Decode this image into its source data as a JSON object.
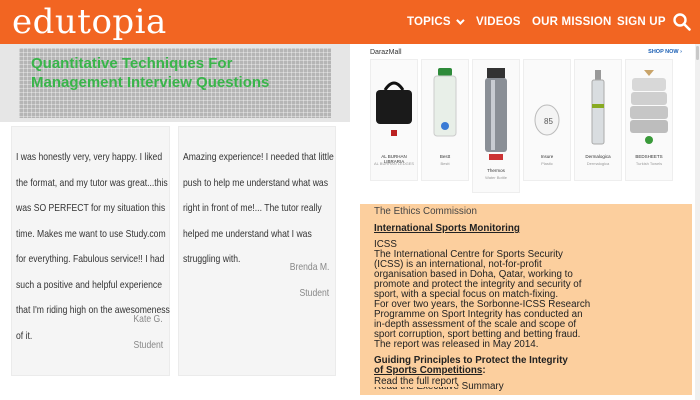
{
  "header": {
    "logo": "edutopia",
    "nav": [
      {
        "label": "TOPICS"
      },
      {
        "label": "VIDEOS"
      },
      {
        "label": "OUR MISSION"
      },
      {
        "label": "SIGN UP"
      }
    ],
    "brand_color": "#f26522"
  },
  "article": {
    "title": "Quantitative Techniques For Management Interview Questions",
    "title_color": "#39b54a"
  },
  "testimonials": [
    {
      "quote": "I was honestly very, very happy. I liked the format, and my tutor was great...this was SO PERFECT for my situation this time. Makes me want to use Study.com for everything. Fabulous service!! I had such a positive and helpful experience that I'm riding high on the awesomeness of it.",
      "author": "Kate G.",
      "role": "Student"
    },
    {
      "quote": "Amazing experience! I needed that little push to help me understand what was right in front of me!... The tutor really helped me understand what I was struggling with.",
      "author": "Brenda M.",
      "role": "Student"
    }
  ],
  "ad": {
    "brand": "DarazMall",
    "shop_now": "SHOP NOW",
    "items": [
      {
        "name": "AL BURHAN LIBRARIA",
        "price": "AL BURHAN LEDGES",
        "icon": "black-handbag-icon"
      },
      {
        "name": "Bestt",
        "price": "Bestt",
        "icon": "bottle-icon"
      },
      {
        "name": "Thermos",
        "price": "Water Bottle",
        "icon": "thermos-icon"
      },
      {
        "name": "Insure",
        "price": "Plastic",
        "icon": "egg-device-icon"
      },
      {
        "name": "Dermalogica",
        "price": "Dermalogica",
        "icon": "serum-bottle-icon"
      },
      {
        "name": "BEDSHEETS",
        "price": "Turkish Towels",
        "icon": "towel-stack-icon"
      }
    ]
  },
  "ethics": {
    "heading": "The Ethics Commission",
    "sub_heading": "International Sports Monitoring",
    "org": "ICSS",
    "lines": [
      "The International Centre for Sports Security",
      "(ICSS) is an international, not-for-profit",
      "organisation based in Doha, Qatar, working to",
      "promote and protect the integrity and security of",
      "sport, with a special focus on match-fixing.",
      "For over two years, the Sorbonne-ICSS Research",
      "Programme on Sport Integrity has conducted an",
      "in-depth assessment of the scale and scope of",
      "sport corruption, sport betting and betting fraud.",
      "The report was released in May 2014."
    ],
    "guiding_1": "Guiding Principles to Protect the Integrity",
    "guiding_2": "of Sports Competitions",
    "guiding_colon": ":",
    "link_summary": "Read the Executive Summary",
    "link_full": "Read the full report",
    "panel_color": "#fccf9e"
  }
}
